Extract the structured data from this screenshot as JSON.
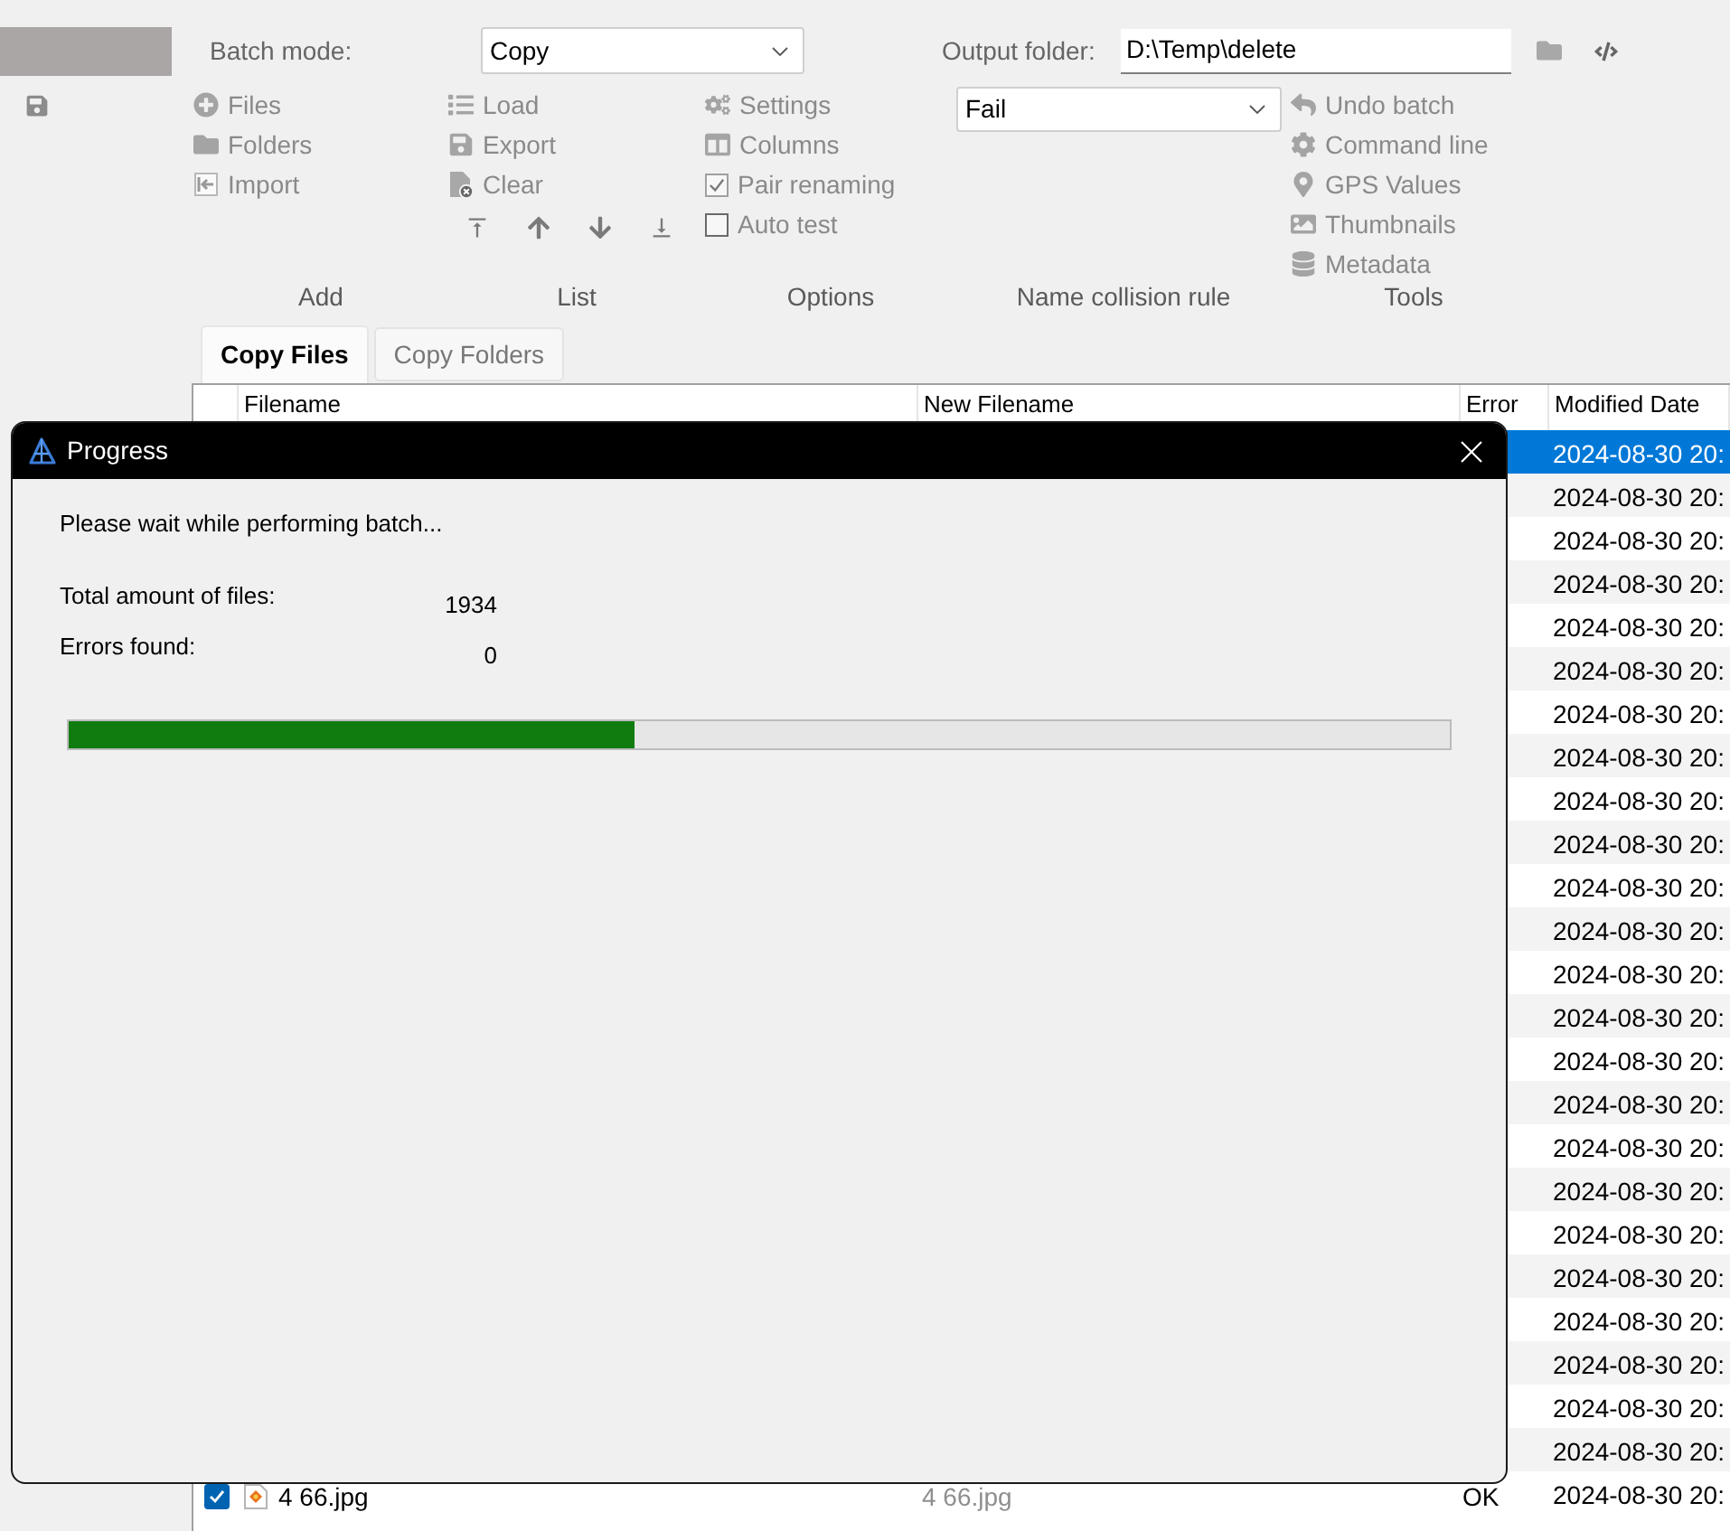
{
  "toolbar": {
    "batch_mode": {
      "label": "Batch mode:",
      "value": "Copy"
    },
    "output_folder": {
      "label": "Output folder:",
      "value": "D:\\Temp\\delete"
    },
    "groups": [
      {
        "kind": "buttons",
        "label": "Add",
        "items": [
          {
            "kind": "button",
            "label": "Files"
          },
          {
            "kind": "button",
            "label": "Folders"
          },
          {
            "kind": "button",
            "label": "Import"
          }
        ]
      },
      {
        "kind": "reorder",
        "label": "List",
        "items": [
          {
            "kind": "button",
            "label": "Load"
          },
          {
            "kind": "button",
            "label": "Export"
          },
          {
            "kind": "button",
            "label": "Clear"
          }
        ]
      },
      {
        "kind": "buttons",
        "label": "Options",
        "items": [
          {
            "kind": "button",
            "label": "Settings"
          },
          {
            "kind": "button",
            "label": "Columns"
          },
          {
            "kind": "checkbox",
            "label": "Pair renaming",
            "checked": true
          },
          {
            "kind": "checkbox",
            "label": "Auto test",
            "checked": false
          }
        ]
      },
      {
        "kind": "dropdown",
        "label": "Name collision rule",
        "value": "Fail"
      },
      {
        "kind": "buttons",
        "label": "Tools",
        "items": [
          {
            "kind": "button",
            "label": "Undo batch"
          },
          {
            "kind": "button",
            "label": "Command line"
          },
          {
            "kind": "button",
            "label": "GPS Values"
          },
          {
            "kind": "button",
            "label": "Thumbnails"
          },
          {
            "kind": "button",
            "label": "Metadata"
          }
        ]
      }
    ]
  },
  "tabs": [
    {
      "label": "Copy Files",
      "selected": true
    },
    {
      "label": "Copy Folders",
      "selected": false
    }
  ],
  "table": {
    "columns": [
      "Filename",
      "New Filename",
      "Error",
      "Modified Date"
    ],
    "rows": [
      {
        "selected": true,
        "modified_date": "2024-08-30 20:"
      },
      {
        "selected": false,
        "modified_date": "2024-08-30 20:"
      },
      {
        "selected": false,
        "modified_date": "2024-08-30 20:"
      },
      {
        "selected": false,
        "modified_date": "2024-08-30 20:"
      },
      {
        "selected": false,
        "modified_date": "2024-08-30 20:"
      },
      {
        "selected": false,
        "modified_date": "2024-08-30 20:"
      },
      {
        "selected": false,
        "modified_date": "2024-08-30 20:"
      },
      {
        "selected": false,
        "modified_date": "2024-08-30 20:"
      },
      {
        "selected": false,
        "modified_date": "2024-08-30 20:"
      },
      {
        "selected": false,
        "modified_date": "2024-08-30 20:"
      },
      {
        "selected": false,
        "modified_date": "2024-08-30 20:"
      },
      {
        "selected": false,
        "modified_date": "2024-08-30 20:"
      },
      {
        "selected": false,
        "modified_date": "2024-08-30 20:"
      },
      {
        "selected": false,
        "modified_date": "2024-08-30 20:"
      },
      {
        "selected": false,
        "modified_date": "2024-08-30 20:"
      },
      {
        "selected": false,
        "modified_date": "2024-08-30 20:"
      },
      {
        "selected": false,
        "modified_date": "2024-08-30 20:"
      },
      {
        "selected": false,
        "modified_date": "2024-08-30 20:"
      },
      {
        "selected": false,
        "modified_date": "2024-08-30 20:"
      },
      {
        "selected": false,
        "modified_date": "2024-08-30 20:"
      },
      {
        "selected": false,
        "modified_date": "2024-08-30 20:"
      },
      {
        "selected": false,
        "modified_date": "2024-08-30 20:"
      },
      {
        "selected": false,
        "modified_date": "2024-08-30 20:"
      },
      {
        "selected": false,
        "modified_date": "2024-08-30 20:"
      },
      {
        "selected": false,
        "checked": true,
        "filename": "4 66.jpg",
        "new_filename": "4 66.jpg",
        "error": "OK",
        "modified_date": "2024-08-30 20:"
      }
    ]
  },
  "dialog": {
    "title": "Progress",
    "message": "Please wait while performing batch...",
    "stats": [
      {
        "label": "Total amount of files:",
        "value": "1934"
      },
      {
        "label": "Errors found:",
        "value": "0"
      }
    ],
    "progress": {
      "level": 0.41
    }
  }
}
